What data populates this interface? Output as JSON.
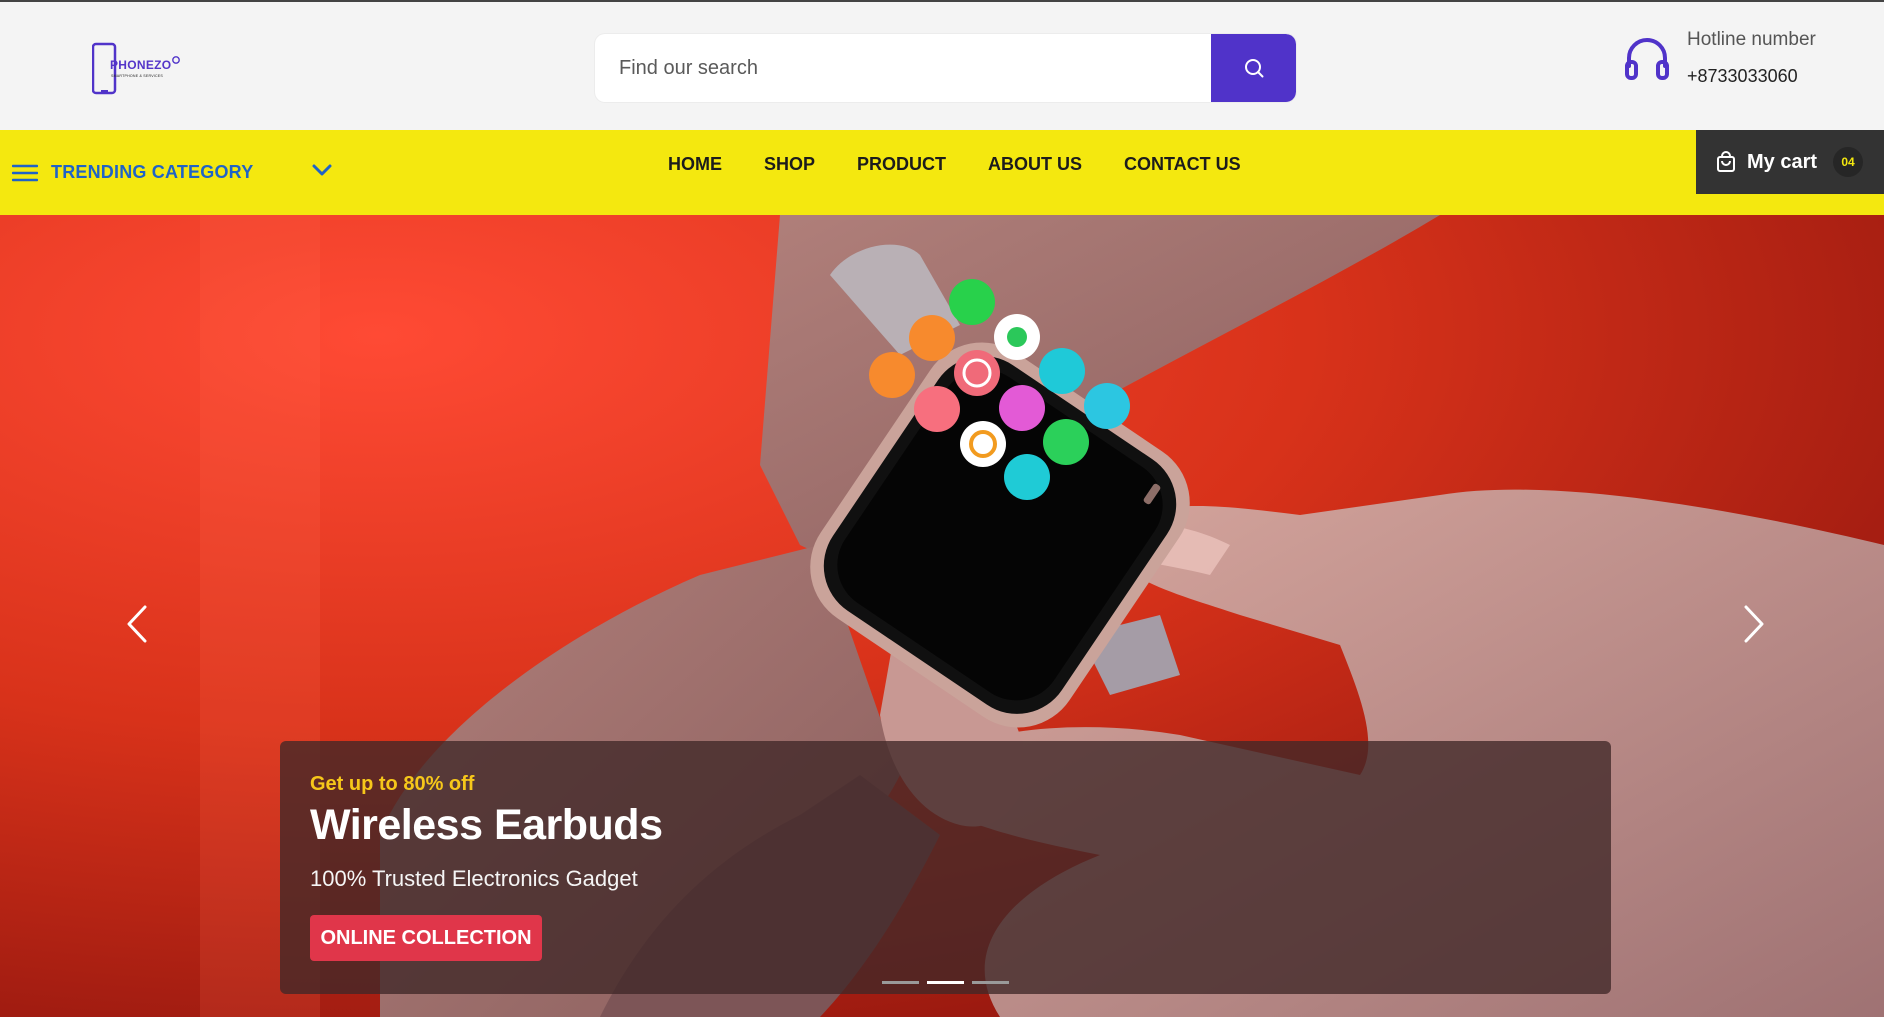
{
  "brand": {
    "name": "PHONEZO",
    "tagline": "SMARTPHONE & SERVICES"
  },
  "search": {
    "placeholder": "Find our search",
    "button_icon": "search-icon"
  },
  "hotline": {
    "icon": "headphones-icon",
    "label": "Hotline number",
    "number": "+8733033060"
  },
  "nav": {
    "category_icon": "hamburger-menu-icon",
    "category_label": "TRENDING CATEGORY",
    "category_chevron": "chevron-down-icon",
    "links": [
      {
        "label": "HOME"
      },
      {
        "label": "SHOP"
      },
      {
        "label": "PRODUCT"
      },
      {
        "label": "ABOUT US"
      },
      {
        "label": "CONTACT US"
      }
    ],
    "cart": {
      "icon": "shopping-bag-icon",
      "label": "My cart",
      "count": "04"
    }
  },
  "hero": {
    "promo": "Get up to 80% off",
    "title": "Wireless Earbuds",
    "subtitle": "100% Trusted Electronics Gadget",
    "cta_label": "ONLINE COLLECTION",
    "prev_icon": "chevron-left-icon",
    "next_icon": "chevron-right-icon",
    "slide_count": 3,
    "active_slide": 2
  },
  "colors": {
    "brand_purple": "#5033c9",
    "nav_yellow": "#f4e80f",
    "category_blue": "#1f63c7",
    "cart_dark": "#333333",
    "promo_yellow": "#f6c71a",
    "cta_red": "#e0364a",
    "hero_red": "#d7321a"
  }
}
